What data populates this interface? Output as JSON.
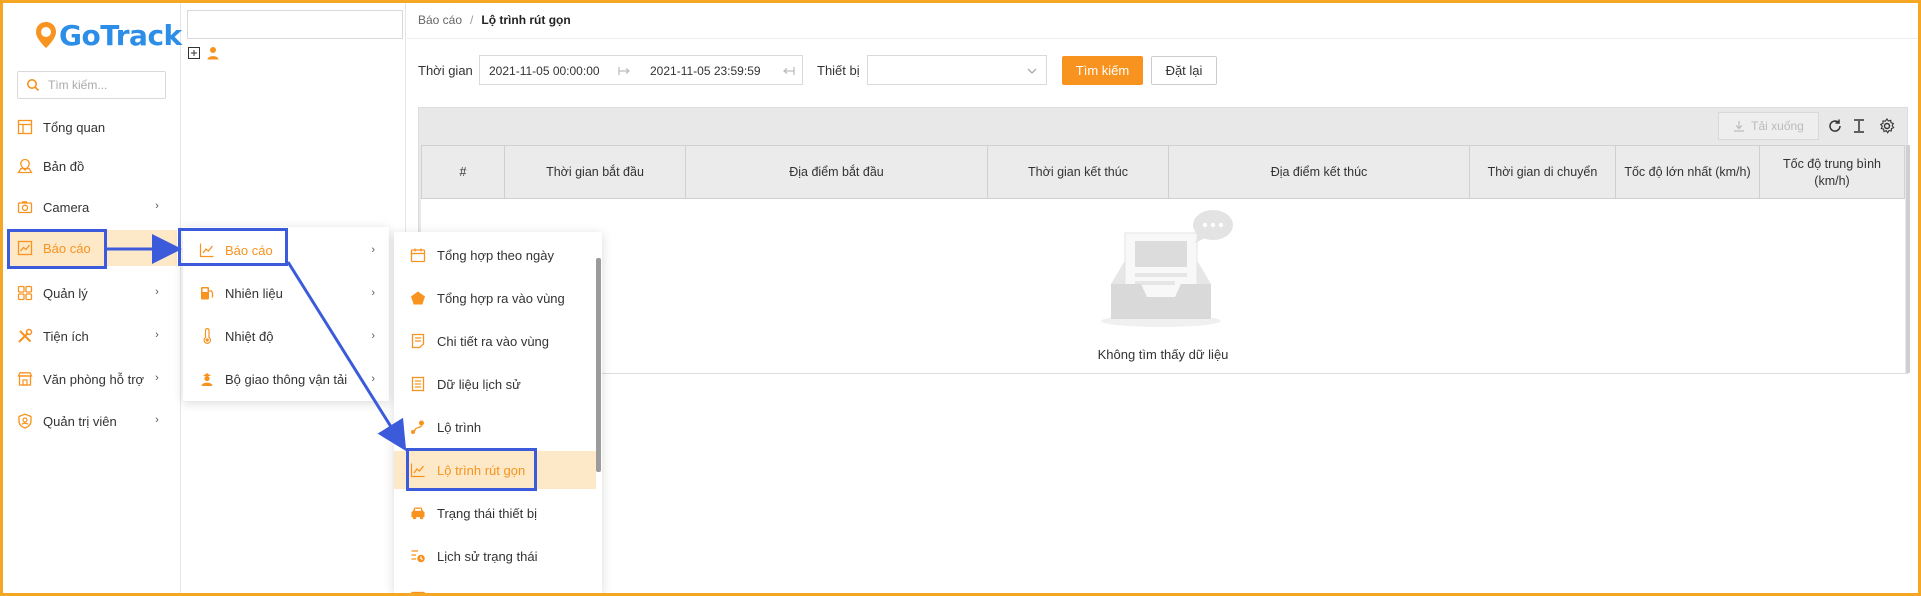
{
  "app": {
    "brand": "GoTrack"
  },
  "sidebar": {
    "search_placeholder": "Tìm kiếm...",
    "items": [
      {
        "label": "Tổng quan",
        "icon": "dashboard-icon"
      },
      {
        "label": "Bản đồ",
        "icon": "map-icon"
      },
      {
        "label": "Camera",
        "icon": "camera-icon"
      },
      {
        "label": "Báo cáo",
        "icon": "report-icon"
      },
      {
        "label": "Quản lý",
        "icon": "grid-icon"
      },
      {
        "label": "Tiện ích",
        "icon": "tools-icon"
      },
      {
        "label": "Văn phòng hỗ trợ",
        "icon": "store-icon"
      },
      {
        "label": "Quản trị viên",
        "icon": "admin-shield-icon"
      }
    ]
  },
  "breadcrumb": {
    "parent": "Báo cáo",
    "separator": "/",
    "current": "Lộ trình rút gọn"
  },
  "filters": {
    "time_label": "Thời gian",
    "start": "2021-11-05 00:00:00",
    "end": "2021-11-05 23:59:59",
    "device_label": "Thiết bị",
    "device_value": "",
    "search_button": "Tìm kiếm",
    "reset_button": "Đặt lại"
  },
  "toolbar": {
    "download_label": "Tải xuống"
  },
  "table": {
    "columns": [
      "#",
      "Thời gian bắt đầu",
      "Địa điểm bắt đầu",
      "Thời gian kết thúc",
      "Địa điểm kết thúc",
      "Thời gian di chuyển",
      "Tốc độ lớn nhất (km/h)",
      "Tốc độ trung bình (km/h)"
    ],
    "empty_text": "Không tìm thấy dữ liệu"
  },
  "flyout_level1": {
    "items": [
      {
        "label": "Báo cáo",
        "icon": "chart-line-icon"
      },
      {
        "label": "Nhiên liệu",
        "icon": "fuel-icon"
      },
      {
        "label": "Nhiệt độ",
        "icon": "thermometer-icon"
      },
      {
        "label": "Bộ giao thông vận tải",
        "icon": "officer-icon"
      }
    ]
  },
  "flyout_level2": {
    "items": [
      {
        "label": "Tổng hợp theo ngày",
        "icon": "calendar-icon"
      },
      {
        "label": "Tổng hợp ra vào vùng",
        "icon": "pentagon-icon"
      },
      {
        "label": "Chi tiết ra vào vùng",
        "icon": "document-icon"
      },
      {
        "label": "Dữ liệu lịch sử",
        "icon": "history-list-icon"
      },
      {
        "label": "Lộ trình",
        "icon": "route-icon"
      },
      {
        "label": "Lộ trình rút gọn",
        "icon": "chart-line-icon"
      },
      {
        "label": "Trạng thái thiết bị",
        "icon": "car-icon"
      },
      {
        "label": "Lịch sử trạng thái",
        "icon": "status-history-icon"
      }
    ]
  },
  "colors": {
    "accent": "#f7931e",
    "active_bg": "#fde8c8",
    "highlight": "#3b5bdb",
    "frame": "#f5a623"
  }
}
